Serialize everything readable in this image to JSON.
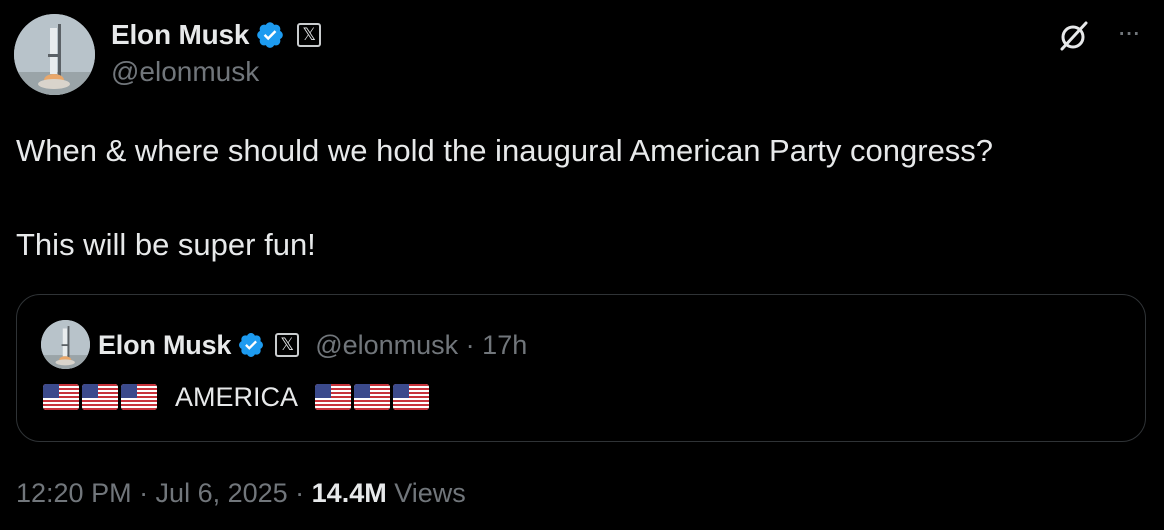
{
  "author": {
    "display_name": "Elon Musk",
    "handle": "@elonmusk",
    "verified_icon": "verified-badge-icon",
    "affiliate_icon": "x-affiliate-icon",
    "affiliate_glyph": "𝕏",
    "avatar": "avatar-rocket-launch"
  },
  "header_actions": {
    "grok_icon": "grok-icon",
    "more_label": "···"
  },
  "tweet": {
    "line1": "When & where should we hold the inaugural American Party congress?",
    "line2": "This will be super fun!"
  },
  "quote": {
    "display_name": "Elon Musk",
    "handle_time": "@elonmusk · 17h",
    "affiliate_glyph": "𝕏",
    "text": "AMERICA",
    "flag_icon": "us-flag-emoji",
    "flags_before": 3,
    "flags_after": 3
  },
  "footer": {
    "time_date": "12:20 PM · Jul 6, 2025 · ",
    "views_count": "14.4M",
    "views_label": " Views"
  },
  "colors": {
    "background": "#000000",
    "primary_text": "#e7e9ea",
    "secondary_text": "#71767b",
    "verified_blue": "#1d9bf0",
    "border": "#2f3336"
  }
}
